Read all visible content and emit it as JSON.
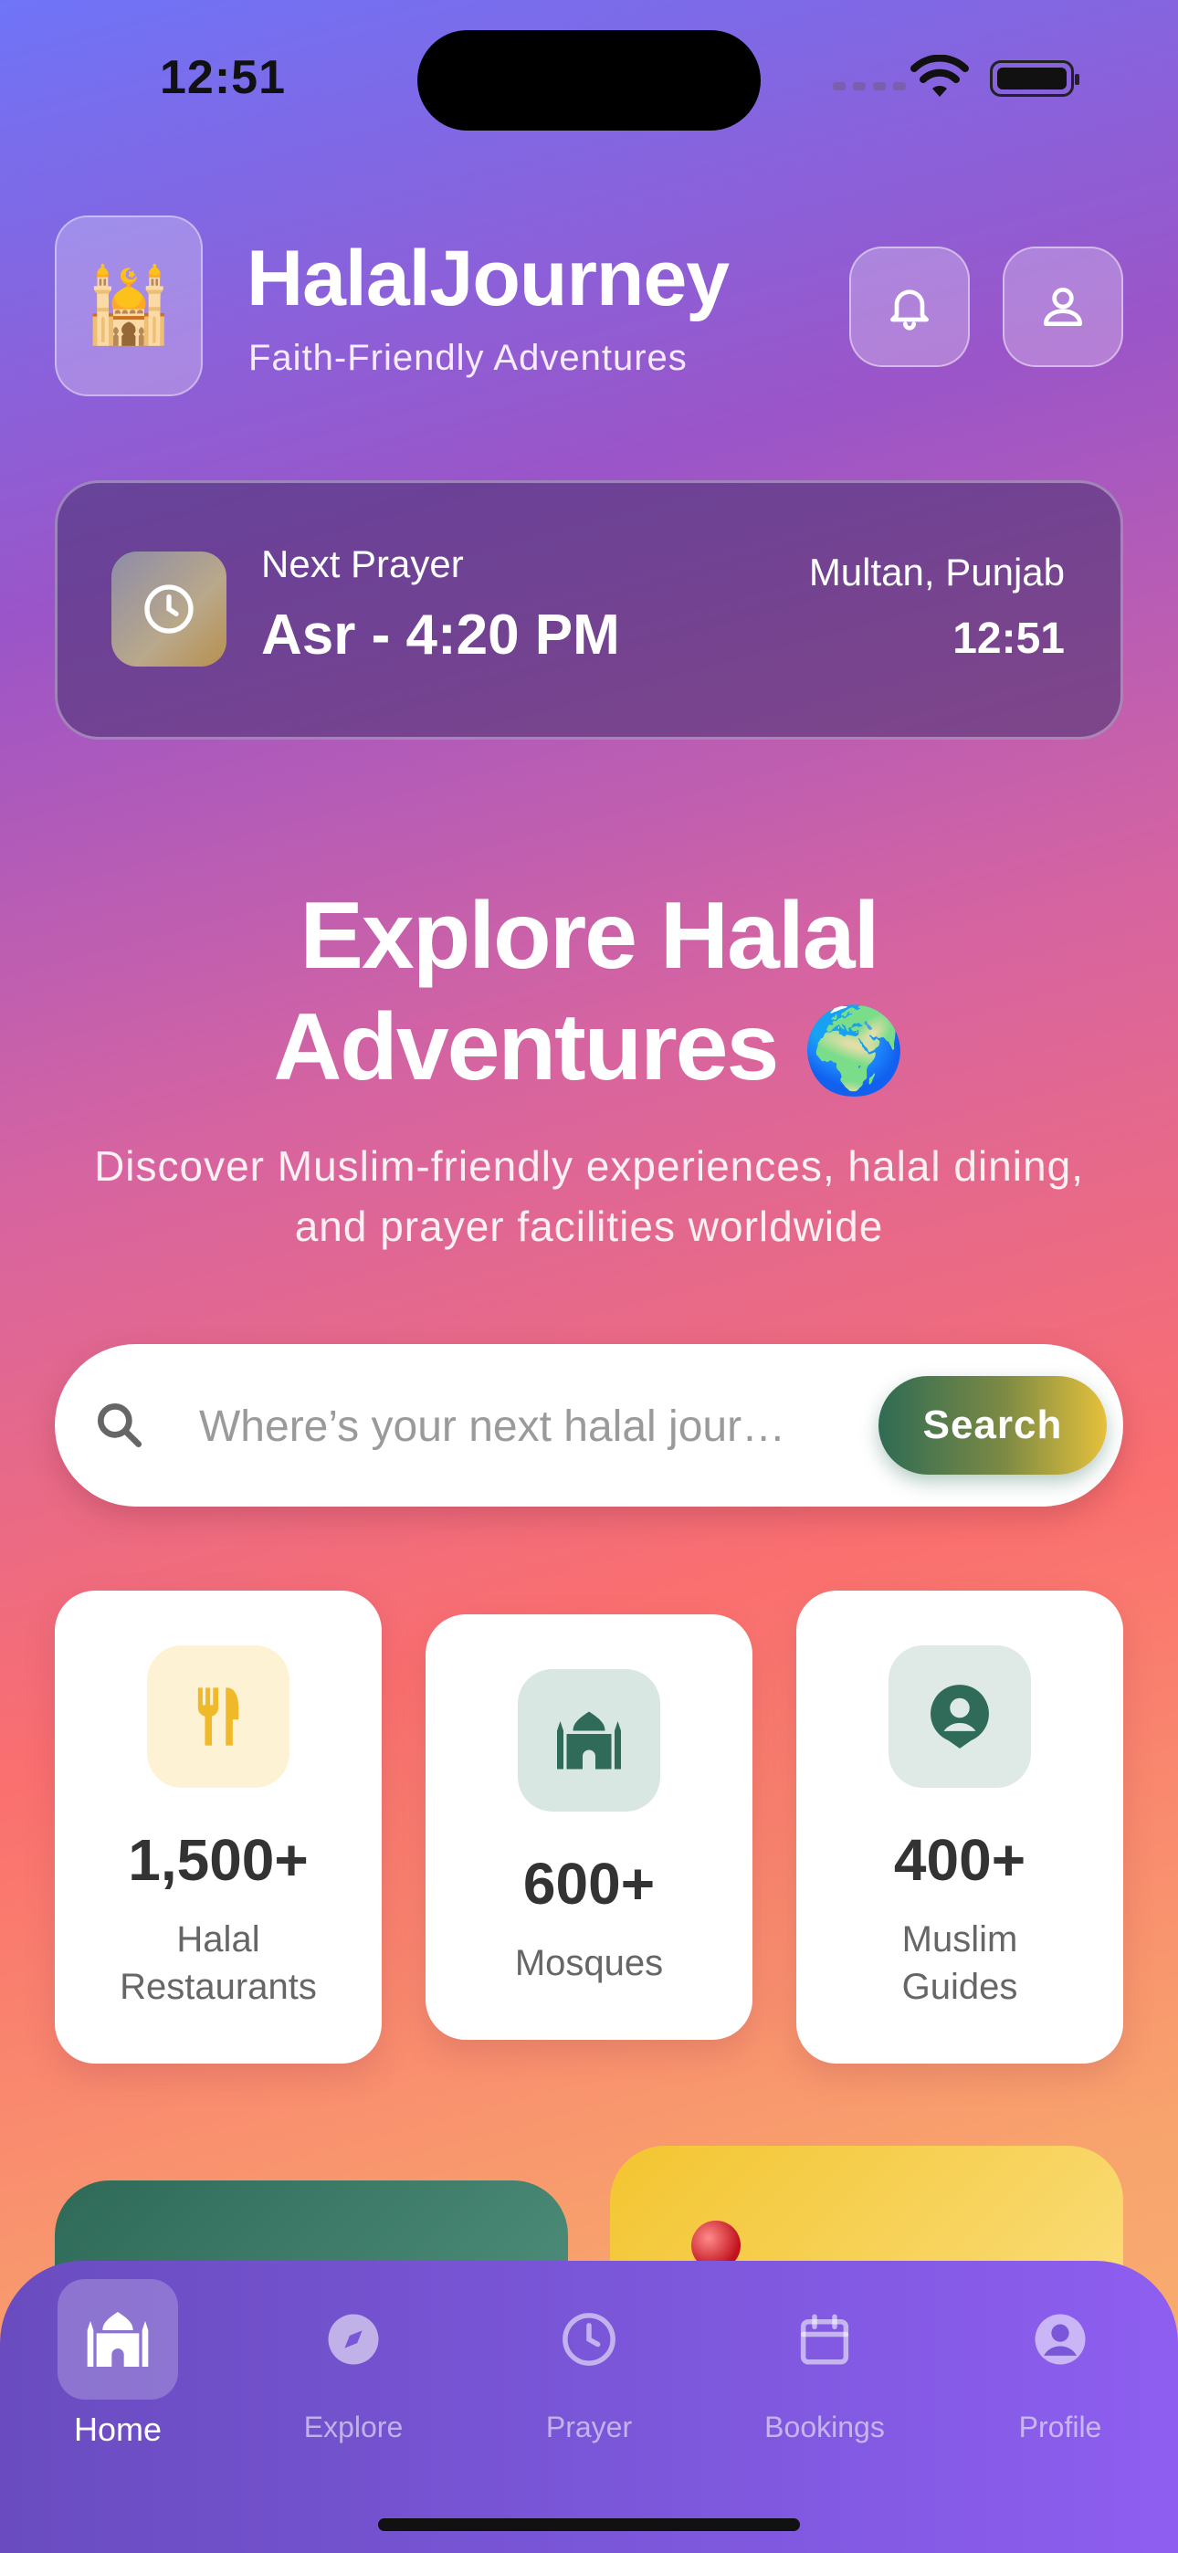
{
  "status_bar": {
    "time": "12:51"
  },
  "header": {
    "logo_emoji": "🕌",
    "title": "HalalJourney",
    "subtitle": "Faith-Friendly Adventures",
    "icons": [
      "bell-icon",
      "user-icon"
    ]
  },
  "prayer": {
    "label": "Next Prayer",
    "value": "Asr - 4:20 PM",
    "location": "Multan, Punjab",
    "time": "12:51"
  },
  "hero": {
    "line1": "Explore Halal",
    "line2": "Adventures",
    "emoji": "🌍",
    "subtitle": "Discover Muslim-friendly experiences, halal dining, and prayer facilities worldwide"
  },
  "search": {
    "placeholder": "Where’s your next halal jour…",
    "button_label": "Search"
  },
  "stats": [
    {
      "number": "1,500+",
      "label_line1": "Halal",
      "label_line2": "Restaurants",
      "icon": "utensils-icon",
      "icon_bg": "#fdf3d4",
      "icon_color": "#f0b92a"
    },
    {
      "number": "600+",
      "label_line1": "Mosques",
      "label_line2": "",
      "icon": "mosque-icon",
      "icon_bg": "#d9e7e3",
      "icon_color": "#2f6b58"
    },
    {
      "number": "400+",
      "label_line1": "Muslim",
      "label_line2": "Guides",
      "icon": "guide-icon",
      "icon_bg": "#dfe9e6",
      "icon_color": "#2f6b58"
    }
  ],
  "nav": [
    {
      "label": "Home",
      "icon": "mosque-home-icon",
      "active": true
    },
    {
      "label": "Explore",
      "icon": "compass-icon",
      "active": false
    },
    {
      "label": "Prayer",
      "icon": "clock-icon",
      "active": false
    },
    {
      "label": "Bookings",
      "icon": "calendar-icon",
      "active": false
    },
    {
      "label": "Profile",
      "icon": "profile-icon",
      "active": false
    }
  ]
}
